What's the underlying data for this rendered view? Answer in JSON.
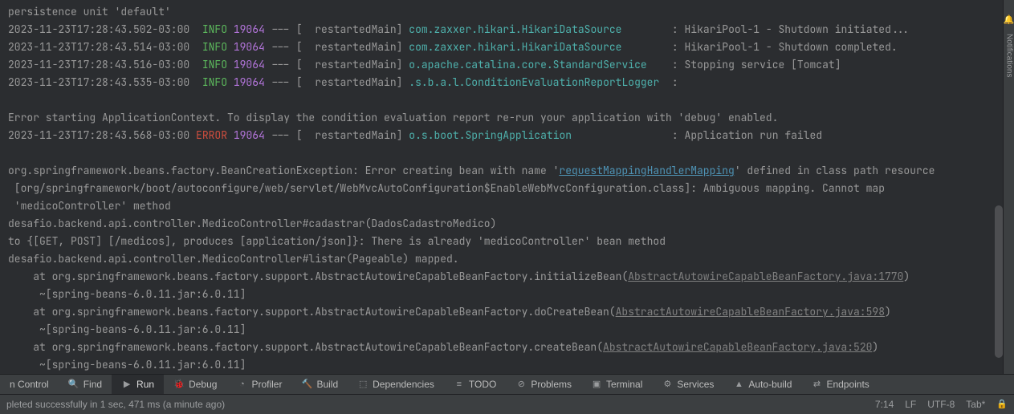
{
  "log": {
    "first_line": "persistence unit 'default'",
    "l1": {
      "ts": "2023-11-23T17:28:43.502-03:00",
      "level": "INFO",
      "pid": "19064",
      "sep": " --- [",
      "thread": "  restartedMain",
      "close": "] ",
      "logger": "com.zaxxer.hikari.HikariDataSource",
      "pad": "       ",
      "msg": " : HikariPool-1 - Shutdown initiated..."
    },
    "l2": {
      "ts": "2023-11-23T17:28:43.514-03:00",
      "level": "INFO",
      "pid": "19064",
      "sep": " --- [",
      "thread": "  restartedMain",
      "close": "] ",
      "logger": "com.zaxxer.hikari.HikariDataSource",
      "pad": "       ",
      "msg": " : HikariPool-1 - Shutdown completed."
    },
    "l3": {
      "ts": "2023-11-23T17:28:43.516-03:00",
      "level": "INFO",
      "pid": "19064",
      "sep": " --- [",
      "thread": "  restartedMain",
      "close": "] ",
      "logger": "o.apache.catalina.core.StandardService",
      "pad": "   ",
      "msg": " : Stopping service [Tomcat]"
    },
    "l4": {
      "ts": "2023-11-23T17:28:43.535-03:00",
      "level": "INFO",
      "pid": "19064",
      "sep": " --- [",
      "thread": "  restartedMain",
      "close": "] ",
      "logger": ".s.b.a.l.ConditionEvaluationReportLogger",
      "pad": " ",
      "msg": " : "
    },
    "blank": "",
    "err_msg": "Error starting ApplicationContext. To display the condition evaluation report re-run your application with 'debug' enabled.",
    "l5": {
      "ts": "2023-11-23T17:28:43.568-03:00",
      "level": "ERROR",
      "pid": "19064",
      "sep": " --- [",
      "thread": "  restartedMain",
      "close": "] ",
      "logger": "o.s.boot.SpringApplication",
      "pad": "               ",
      "msg": " : Application run failed"
    },
    "ex1a": "org.springframework.beans.factory.BeanCreationException: Error creating bean with name '",
    "ex1_link": "requestMappingHandlerMapping",
    "ex1b": "' defined in class path resource",
    "ex2": " [org/springframework/boot/autoconfigure/web/servlet/WebMvcAutoConfiguration$EnableWebMvcConfiguration.class]: Ambiguous mapping. Cannot map",
    "ex3": " 'medicoController' method ",
    "ex4": "desafio.backend.api.controller.MedicoController#cadastrar(DadosCadastroMedico)",
    "ex5": "to {[GET, POST] [/medicos], produces [application/json]}: There is already 'medicoController' bean method",
    "ex6": "desafio.backend.api.controller.MedicoController#listar(Pageable) mapped.",
    "st1a": "    at org.springframework.beans.factory.support.AbstractAutowireCapableBeanFactory.initializeBean(",
    "st1_link": "AbstractAutowireCapableBeanFactory.java:1770",
    "st1b": ")",
    "st1c": "     ~[spring-beans-6.0.11.jar:6.0.11]",
    "st2a": "    at org.springframework.beans.factory.support.AbstractAutowireCapableBeanFactory.doCreateBean(",
    "st2_link": "AbstractAutowireCapableBeanFactory.java:598",
    "st2b": ")",
    "st2c": "     ~[spring-beans-6.0.11.jar:6.0.11]",
    "st3a": "    at org.springframework.beans.factory.support.AbstractAutowireCapableBeanFactory.createBean(",
    "st3_link": "AbstractAutowireCapableBeanFactory.java:520",
    "st3b": ")",
    "st3c": "     ~[spring-beans-6.0.11.jar:6.0.11]"
  },
  "sidebar": {
    "notifications": "Notifications"
  },
  "toolbar": {
    "version_control": "n Control",
    "find": "Find",
    "run": "Run",
    "debug": "Debug",
    "profiler": "Profiler",
    "build": "Build",
    "dependencies": "Dependencies",
    "todo": "TODO",
    "problems": "Problems",
    "terminal": "Terminal",
    "services": "Services",
    "autobuild": "Auto-build",
    "endpoints": "Endpoints"
  },
  "status": {
    "left": "pleted successfully in 1 sec, 471 ms (a minute ago)",
    "pos": "7:14",
    "eol": "LF",
    "enc": "UTF-8",
    "tab": "Tab*"
  }
}
